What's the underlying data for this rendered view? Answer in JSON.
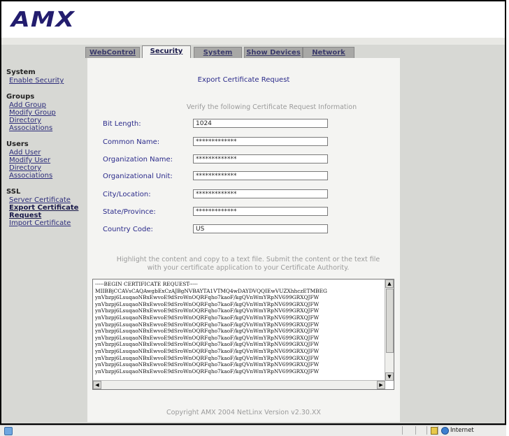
{
  "brand": {
    "logo": "AMX"
  },
  "tabs": [
    {
      "label": "WebControl",
      "active": false
    },
    {
      "label": "Security",
      "active": true
    },
    {
      "label": "System",
      "active": false
    },
    {
      "label": "Show Devices",
      "active": false
    },
    {
      "label": "Network",
      "active": false
    }
  ],
  "sidebar": {
    "system": {
      "heading": "System",
      "items": [
        "Enable Security"
      ]
    },
    "groups": {
      "heading": "Groups",
      "items": [
        "Add Group",
        "Modify Group",
        "Directory",
        "Associations"
      ]
    },
    "users": {
      "heading": "Users",
      "items": [
        "Add User",
        "Modify User",
        "Directory",
        "Associations"
      ]
    },
    "ssl": {
      "heading": "SSL",
      "items": [
        "Server Certificate",
        "Export Certificate",
        "Request",
        "Import Certificate"
      ]
    }
  },
  "main": {
    "title": "Export Certificate Request",
    "verify_text": "Verify the following Certificate Request Information",
    "fields": [
      {
        "label": "Bit Length:",
        "value": "1024"
      },
      {
        "label": "Common Name:",
        "value": "*************"
      },
      {
        "label": "Organization Name:",
        "value": "*************"
      },
      {
        "label": "Organizational Unit:",
        "value": "*************"
      },
      {
        "label": "City/Location:",
        "value": "*************"
      },
      {
        "label": "State/Province:",
        "value": "*************"
      },
      {
        "label": "Country Code:",
        "value": "US"
      }
    ],
    "highlight_line1": "Highlight the content and copy to a text file. Submit the content or the text file",
    "highlight_line2": "with your certificate application to your Certificate Authority.",
    "certificate_text": "-----BEGIN CERTIFICATE REQUEST-----\nMIIBBjCCAVsCAQAwgbExCzAJBgNVBAYTA1VTMQ4wDAYDVQQIEwVUZXhhczETMBEG\nynVbzpj6LsuqaoNBxEwvoE9dSroWnOQRFqho7kaoF/kgQVnWmYRpNV699GRXQJFW\nynVbzpj6LsuqaoNBxEwvoE9dSroWnOQRFqho7kaoF/kgQVnWmYRpNV699GRXQJFW\nynVbzpj6LsuqaoNBxEwvoE9dSroWnOQRFqho7kaoF/kgQVnWmYRpNV699GRXQJFW\nynVbzpj6LsuqaoNBxEwvoE9dSroWnOQRFqho7kaoF/kgQVnWmYRpNV699GRXQJFW\nynVbzpj6LsuqaoNBxEwvoE9dSroWnOQRFqho7kaoF/kgQVnWmYRpNV699GRXQJFW\nynVbzpj6LsuqaoNBxEwvoE9dSroWnOQRFqho7kaoF/kgQVnWmYRpNV699GRXQJFW\nynVbzpj6LsuqaoNBxEwvoE9dSroWnOQRFqho7kaoF/kgQVnWmYRpNV699GRXQJFW\nynVbzpj6LsuqaoNBxEwvoE9dSroWnOQRFqho7kaoF/kgQVnWmYRpNV699GRXQJFW\nynVbzpj6LsuqaoNBxEwvoE9dSroWnOQRFqho7kaoF/kgQVnWmYRpNV699GRXQJFW\nynVbzpj6LsuqaoNBxEwvoE9dSroWnOQRFqho7kaoF/kgQVnWmYRpNV699GRXQJFW\nynVbzpj6LsuqaoNBxEwvoE9dSroWnOQRFqho7kaoF/kgQVnWmYRpNV699GRXQJFW\nynVbzpj6LsuqaoNBxEwvoE9dSroWnOQRFqho7kaoF/kgQVnWmYRpNV699GRXQJFW",
    "footer": "Copyright AMX 2004   NetLinx Version v2.30.XX"
  },
  "status": {
    "zone": "Internet"
  },
  "icons": {
    "status": "page-icon",
    "lock": "lock-icon",
    "zone": "globe-icon"
  }
}
